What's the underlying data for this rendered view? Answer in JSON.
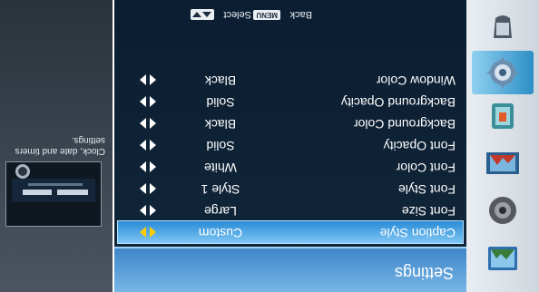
{
  "sidebar": {
    "items": [
      {
        "icon": "picture-icon"
      },
      {
        "icon": "audio-icon"
      },
      {
        "icon": "channel-icon"
      },
      {
        "icon": "parental-control-icon"
      },
      {
        "icon": "settings-gear-icon",
        "active": true
      },
      {
        "icon": "support-icon"
      }
    ]
  },
  "panel": {
    "title": "Settings",
    "rows": [
      {
        "label": "Caption Style",
        "value": "Custom"
      },
      {
        "label": "Font Size",
        "value": "Large"
      },
      {
        "label": "Font Style",
        "value": "Style 1"
      },
      {
        "label": "Font Color",
        "value": "White"
      },
      {
        "label": "Font Opacity",
        "value": "Solid"
      },
      {
        "label": "Background Color",
        "value": "Black"
      },
      {
        "label": "Background Opacity",
        "value": "Solid"
      },
      {
        "label": "Window Color",
        "value": "Black"
      }
    ],
    "hint": {
      "back": "Back",
      "menu_key": "MENU",
      "select": "Select"
    }
  },
  "info": {
    "description": "Clock, date and timers settings."
  },
  "colors": {
    "accent": "#3e86c9",
    "selection": "#2a8cd6",
    "arrow": "#ffcc00"
  }
}
